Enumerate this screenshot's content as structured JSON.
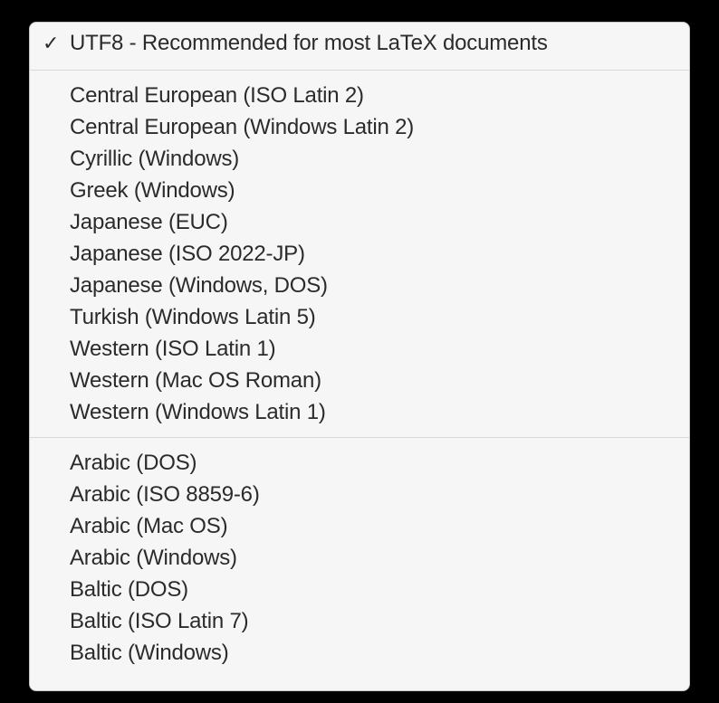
{
  "menu": {
    "sections": [
      {
        "items": [
          {
            "label": "UTF8 - Recommended for most LaTeX documents",
            "checked": true
          }
        ]
      },
      {
        "items": [
          {
            "label": "Central European (ISO Latin 2)",
            "checked": false
          },
          {
            "label": "Central European (Windows Latin 2)",
            "checked": false
          },
          {
            "label": "Cyrillic (Windows)",
            "checked": false
          },
          {
            "label": "Greek (Windows)",
            "checked": false
          },
          {
            "label": "Japanese (EUC)",
            "checked": false
          },
          {
            "label": "Japanese (ISO 2022-JP)",
            "checked": false
          },
          {
            "label": "Japanese (Windows, DOS)",
            "checked": false
          },
          {
            "label": "Turkish (Windows Latin 5)",
            "checked": false
          },
          {
            "label": "Western (ISO Latin 1)",
            "checked": false
          },
          {
            "label": "Western (Mac OS Roman)",
            "checked": false
          },
          {
            "label": "Western (Windows Latin 1)",
            "checked": false
          }
        ]
      },
      {
        "items": [
          {
            "label": "Arabic (DOS)",
            "checked": false
          },
          {
            "label": "Arabic (ISO 8859-6)",
            "checked": false
          },
          {
            "label": "Arabic (Mac OS)",
            "checked": false
          },
          {
            "label": "Arabic (Windows)",
            "checked": false
          },
          {
            "label": "Baltic (DOS)",
            "checked": false
          },
          {
            "label": "Baltic (ISO Latin 7)",
            "checked": false
          },
          {
            "label": "Baltic (Windows)",
            "checked": false
          }
        ]
      }
    ]
  },
  "icons": {
    "check": "✓"
  }
}
